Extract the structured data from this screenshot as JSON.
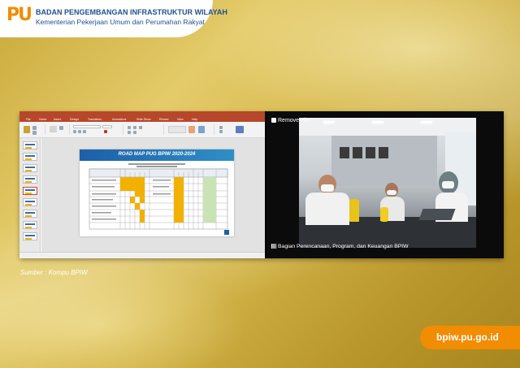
{
  "header": {
    "logo_text": "PU",
    "org_name": "BADAN PENGEMBANGAN INFRASTRUKTUR WILAYAH",
    "ministry": "Kementerian Pekerjaan Umum dan Perumahan Rakyat"
  },
  "powerpoint": {
    "tabs": [
      "File",
      "Home",
      "Insert",
      "Design",
      "Transitions",
      "Animations",
      "Slide Show",
      "Review",
      "View",
      "Help"
    ],
    "slide_title": "ROAD MAP PUG BPIW 2020-2024"
  },
  "video": {
    "participant_top": "Remove Pin",
    "participant_bottom": "Bagian Perencanaan, Program, dan Keuangan  BPIW"
  },
  "source": "Sumber : Kompu BPIW",
  "site_url": "bpiw.pu.go.id",
  "colors": {
    "brand_orange": "#f28c00",
    "brand_blue": "#1f4f96",
    "ppt_red": "#b7472a",
    "table_yellow": "#f2b100",
    "table_green": "#c9e3b5"
  }
}
